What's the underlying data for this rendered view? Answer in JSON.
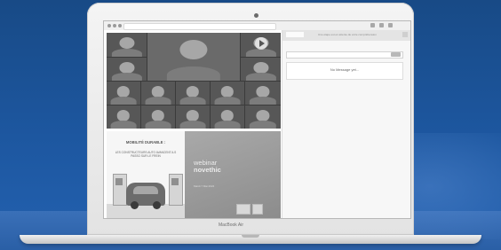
{
  "screen": {
    "chat": {
      "header_text": "Une étape est en attente de votre compréhension",
      "empty_message": "No Message yet..."
    },
    "slide": {
      "title": "MOBILITÉ DURABLE :",
      "subtitle": "LES CONSTRUCTEURS AUTO AVANCENT-ILS PASSO SUR LE FREIN",
      "webinar_word": "webinar",
      "brand_name": "novethic",
      "date_text": "Mardi 7 Mai 2024"
    }
  },
  "laptop": {
    "model": "MacBook Air"
  },
  "colors": {
    "background_blue": "#1d57a0",
    "laptop_silver": "#ececec"
  }
}
